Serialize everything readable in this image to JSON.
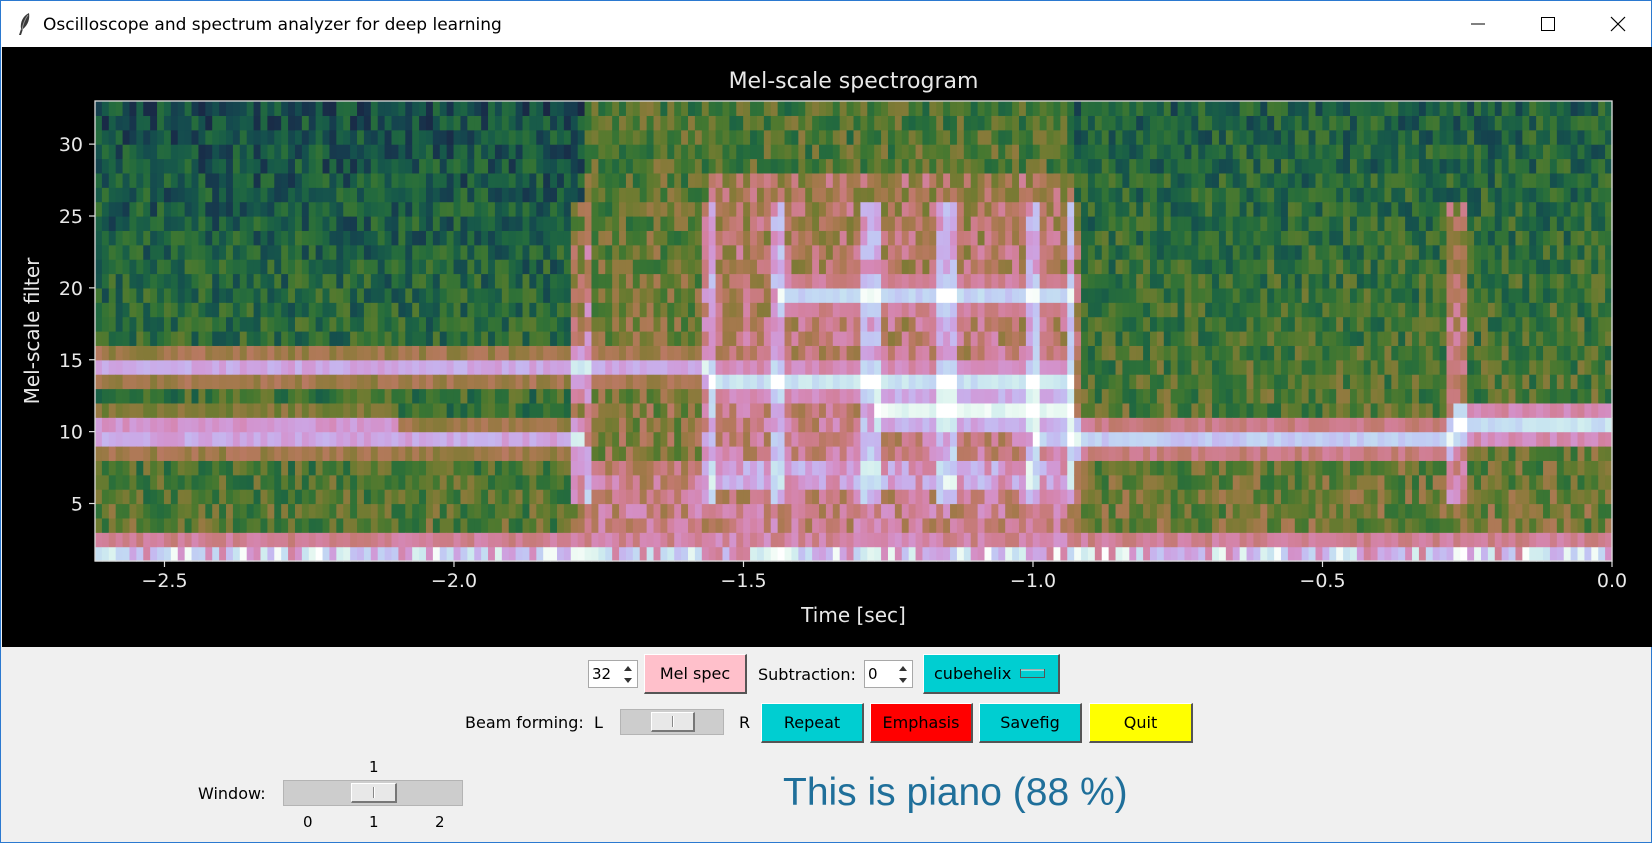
{
  "window": {
    "title": "Oscilloscope and spectrum analyzer for deep learning",
    "icons": {
      "app": "feather-icon",
      "minimize": "minimize-icon",
      "maximize": "maximize-icon",
      "close": "close-icon"
    }
  },
  "chart_data": {
    "type": "heatmap",
    "title": "Mel-scale spectrogram",
    "xlabel": "Time [sec]",
    "ylabel": "Mel-scale filter",
    "xlim": [
      -2.62,
      0.0
    ],
    "ylim": [
      1,
      33
    ],
    "x_ticks": [
      "−2.5",
      "−2.0",
      "−1.5",
      "−1.0",
      "−0.5",
      "0.0"
    ],
    "x_tick_values": [
      -2.5,
      -2.0,
      -1.5,
      -1.0,
      -0.5,
      0.0
    ],
    "y_ticks": [
      "5",
      "10",
      "15",
      "20",
      "25",
      "30"
    ],
    "y_tick_values": [
      5,
      10,
      15,
      20,
      25,
      30
    ],
    "colormap": "cubehelix",
    "mel_filters": 32,
    "onset_times": [
      -1.78,
      -1.56,
      -1.44,
      -1.28,
      -1.15,
      -1.0,
      -0.93,
      -0.27
    ],
    "strong_bands": [
      {
        "filter": 9,
        "from": -2.62,
        "to": -1.78,
        "level": 0.72
      },
      {
        "filter": 10,
        "from": -2.62,
        "to": -2.1,
        "level": 0.68
      },
      {
        "filter": 14,
        "from": -2.62,
        "to": -1.56,
        "level": 0.72
      },
      {
        "filter": 13,
        "from": -1.56,
        "to": -0.93,
        "level": 0.86
      },
      {
        "filter": 11,
        "from": -1.28,
        "to": -0.93,
        "level": 0.95
      },
      {
        "filter": 19,
        "from": -1.44,
        "to": -0.93,
        "level": 0.82
      },
      {
        "filter": 9,
        "from": -1.0,
        "to": -0.27,
        "level": 0.8
      },
      {
        "filter": 10,
        "from": -0.27,
        "to": 0.0,
        "level": 0.86
      },
      {
        "filter": 1,
        "from": -2.62,
        "to": 0.0,
        "level": 0.82
      }
    ]
  },
  "controls": {
    "mel_filters_value": "32",
    "mel_spec_label": "Mel spec",
    "subtraction_label": "Subtraction:",
    "subtraction_value": "0",
    "colormap_label": "cubehelix",
    "beam_forming_label": "Beam forming:",
    "beam_left": "L",
    "beam_right": "R",
    "beam_position": 0.5,
    "repeat_label": "Repeat",
    "emphasis_label": "Emphasis",
    "savefig_label": "Savefig",
    "quit_label": "Quit",
    "window_label": "Window:",
    "window_value": "1",
    "window_ticks": [
      "0",
      "1",
      "2"
    ],
    "colors": {
      "mel_spec": "#ffc0cb",
      "repeat": "#00ced1",
      "emphasis": "#ff0000",
      "savefig": "#00ced1",
      "quit": "#ffff00",
      "cubehelix": "#00ced1"
    }
  },
  "result": {
    "text": "This is piano (88 %)",
    "color": "#1f6f9a"
  }
}
